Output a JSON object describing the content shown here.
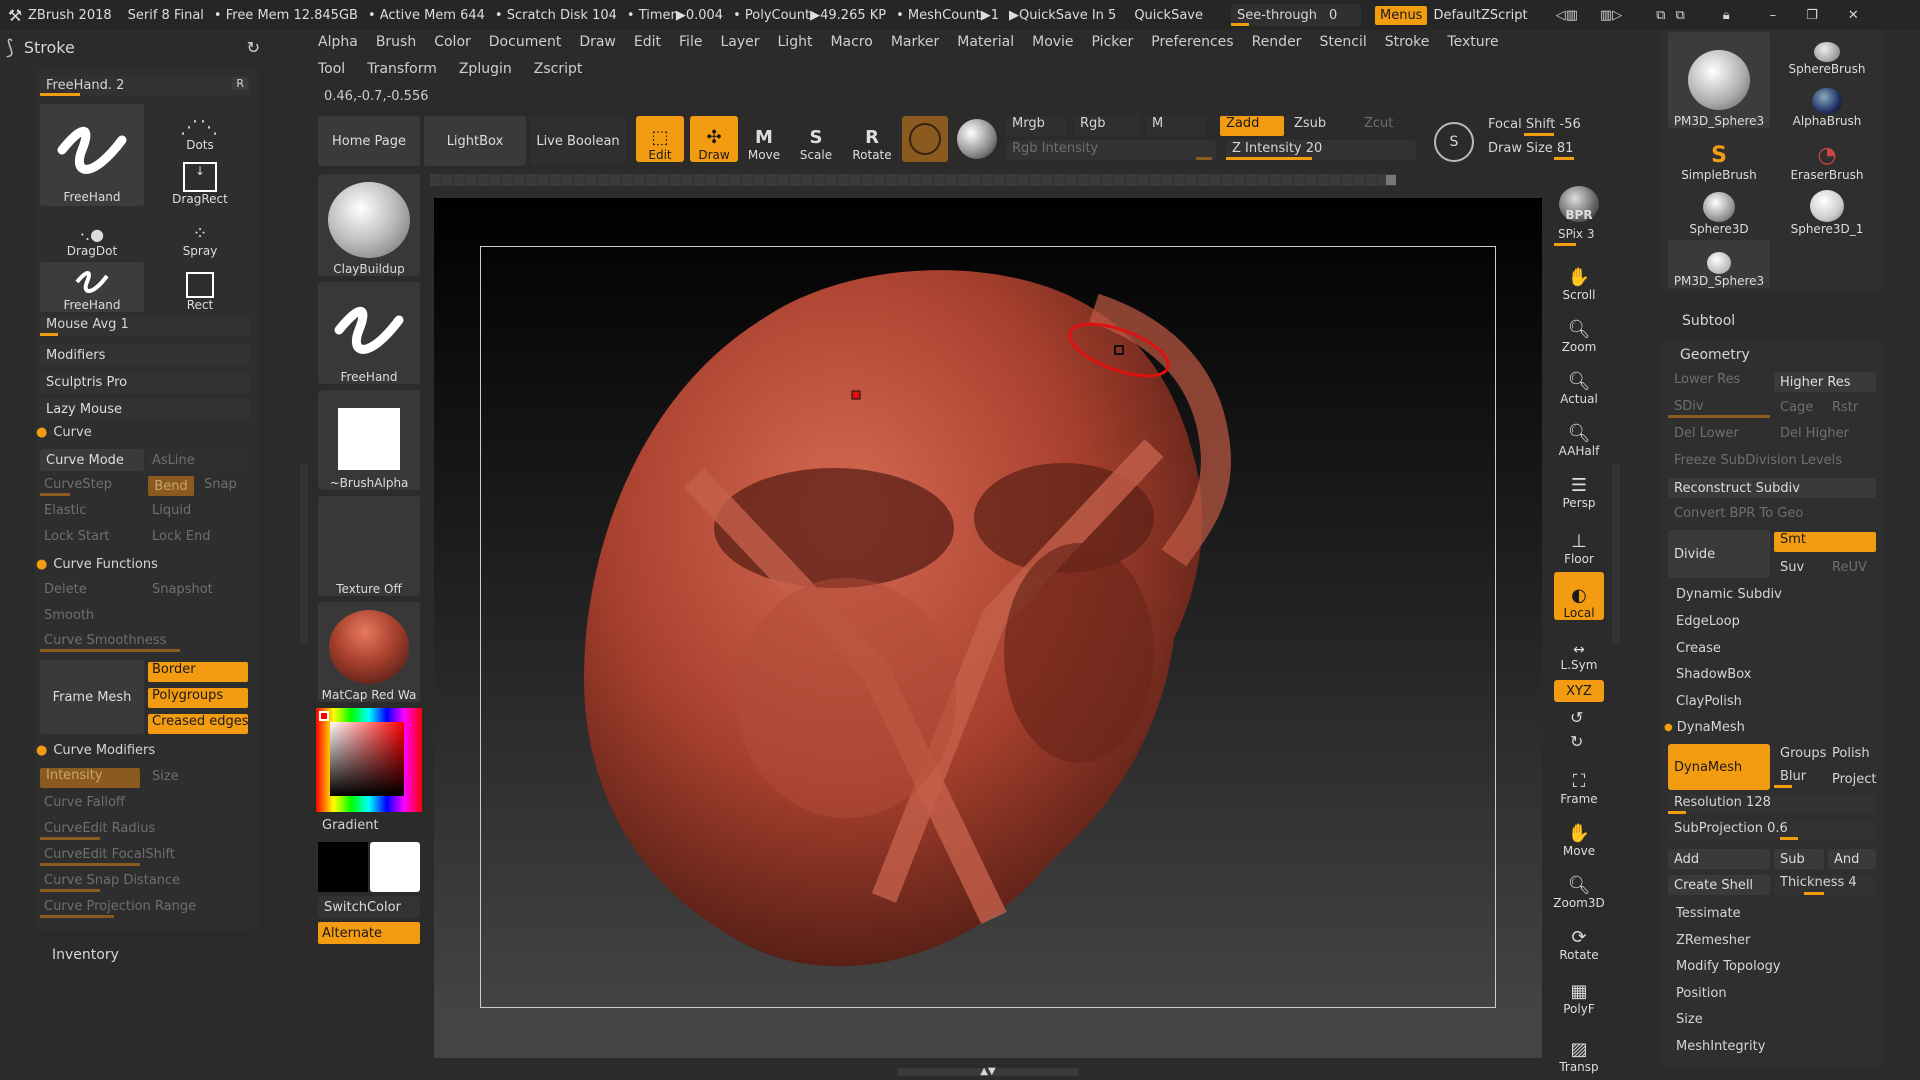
{
  "titlebar": {
    "app": "ZBrush 2018",
    "project": "Serif 8 Final",
    "freemem": "• Free Mem 12.845GB",
    "activemem": "• Active Mem 644",
    "scratch": "• Scratch Disk 104",
    "timer": "• Timer▶0.004",
    "polycount": "• PolyCount▶49.265 KP",
    "meshcount": "• MeshCount▶1",
    "quicksave_in": "▶QuickSave In 5",
    "quicksave": "QuickSave",
    "seethrough": "See-through",
    "seethrough_val": "0",
    "menus": "Menus",
    "script": "DefaultZScript"
  },
  "menubar": [
    "Alpha",
    "Brush",
    "Color",
    "Document",
    "Draw",
    "Edit",
    "File",
    "Layer",
    "Light",
    "Macro",
    "Marker",
    "Material",
    "Movie",
    "Picker",
    "Preferences",
    "Render",
    "Stencil",
    "Stroke",
    "Texture"
  ],
  "menubar2": [
    "Tool",
    "Transform",
    "Zplugin",
    "Zscript"
  ],
  "coords": "0.46,-0.7,-0.556",
  "stroke": {
    "title": "Stroke",
    "freehand_slider": "FreeHand. 2",
    "r": "R",
    "types": [
      "FreeHand",
      "Dots",
      "DragRect",
      "DragDot",
      "Spray",
      "FreeHand",
      "Rect"
    ],
    "mouse_avg": "Mouse Avg 1",
    "modifiers": "Modifiers",
    "sculptris": "Sculptris Pro",
    "lazy": "Lazy Mouse",
    "curve": "Curve",
    "curve_mode": "Curve Mode",
    "asline": "AsLine",
    "curvestep": "CurveStep",
    "bend": "Bend",
    "snap": "Snap",
    "elastic": "Elastic",
    "liquid": "Liquid",
    "lockstart": "Lock Start",
    "lockend": "Lock End",
    "curve_functions": "Curve Functions",
    "delete": "Delete",
    "snapshot": "Snapshot",
    "smooth": "Smooth",
    "curve_smooth": "Curve Smoothness",
    "frame_mesh": "Frame Mesh",
    "border": "Border",
    "polygroups": "Polygroups",
    "creased": "Creased edges",
    "curve_modifiers": "Curve Modifiers",
    "intensity": "Intensity",
    "size": "Size",
    "falloff": "Curve Falloff",
    "edit_radius": "CurveEdit Radius",
    "edit_focal": "CurveEdit FocalShift",
    "snap_dist": "Curve Snap Distance",
    "proj_range": "Curve Projection Range",
    "inventory": "Inventory"
  },
  "toolbar": {
    "home": "Home Page",
    "lightbox": "LightBox",
    "liveboolean": "Live Boolean",
    "edit": "Edit",
    "draw": "Draw",
    "move": "Move",
    "scale": "Scale",
    "rotate": "Rotate",
    "mrgb": "Mrgb",
    "rgb": "Rgb",
    "m": "M",
    "zadd": "Zadd",
    "zsub": "Zsub",
    "zcut": "Zcut",
    "rgb_intensity": "Rgb Intensity",
    "z_intensity": "Z Intensity 20",
    "focal": "Focal Shift -56",
    "drawsize": "Draw Size 81"
  },
  "shelf": {
    "brush": "ClayBuildup",
    "stroke": "FreeHand",
    "alpha": "~BrushAlpha",
    "texture": "Texture Off",
    "material": "MatCap Red Wa",
    "gradient": "Gradient",
    "switch": "SwitchColor",
    "alternate": "Alternate"
  },
  "rightshelf": [
    "BPR",
    "SPix 3",
    "Scroll",
    "Zoom",
    "Actual",
    "AAHalf",
    "Persp",
    "Floor",
    "Local",
    "L.Sym",
    "XYZ",
    "Frame",
    "Move",
    "Zoom3D",
    "Rotate",
    "PolyF",
    "Transp"
  ],
  "tools": [
    "PM3D_Sphere3",
    "SphereBrush",
    "AlphaBrush",
    "SimpleBrush",
    "EraserBrush",
    "Sphere3D",
    "Sphere3D_1",
    "PM3D_Sphere3"
  ],
  "subtool": "Subtool",
  "geometry": {
    "title": "Geometry",
    "lower": "Lower Res",
    "higher": "Higher Res",
    "sdiv": "SDiv",
    "cage": "Cage",
    "rstr": "Rstr",
    "dellower": "Del Lower",
    "delhigher": "Del Higher",
    "freeze": "Freeze SubDivision Levels",
    "reconstruct": "Reconstruct Subdiv",
    "convert": "Convert BPR To Geo",
    "divide": "Divide",
    "smt": "Smt",
    "suv": "Suv",
    "reuv": "ReUV",
    "dynamic": "Dynamic Subdiv",
    "edgeloop": "EdgeLoop",
    "crease": "Crease",
    "shadowbox": "ShadowBox",
    "claypolish": "ClayPolish",
    "dynamesh_title": "DynaMesh",
    "dynamesh": "DynaMesh",
    "groups": "Groups",
    "polish": "Polish",
    "blur": "Blur",
    "project": "Project",
    "resolution": "Resolution 128",
    "subproj": "SubProjection 0.6",
    "add": "Add",
    "sub": "Sub",
    "and": "And",
    "createshell": "Create Shell",
    "thickness": "Thickness 4",
    "tessimate": "Tessimate",
    "zremesher": "ZRemesher",
    "modtopo": "Modify Topology",
    "position": "Position",
    "size": "Size",
    "meshint": "MeshIntegrity"
  },
  "colors": {
    "accent": "#f39c12",
    "model": "#a8402e"
  }
}
